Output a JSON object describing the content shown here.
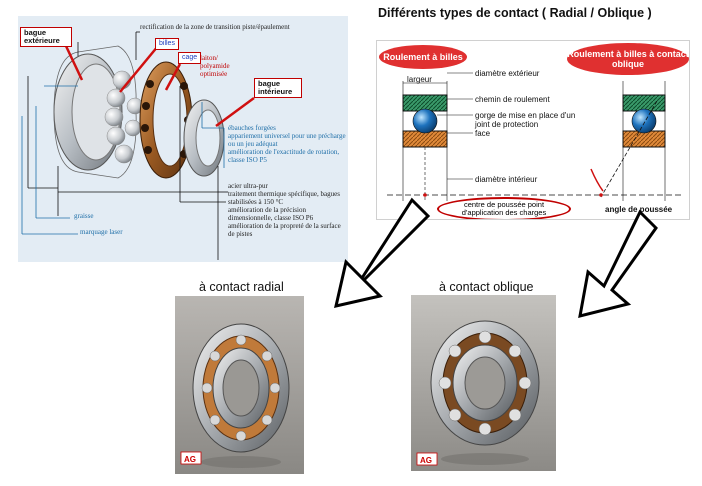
{
  "title": "Différents types de contact ( Radial / Oblique )",
  "left_figure": {
    "top_note": "rectification de la zone de transition piste/épaulement",
    "outer_ring_label": "bague extérieure",
    "balls_label": "billes",
    "cage_label": "cage",
    "cage_material": "laiton/ polyamide optimisée",
    "inner_ring_label": "bague intérieure",
    "blue_features": [
      "ébauches forgées",
      "appariement universel pour une précharge ou un jeu adéquat",
      "amélioration de l'exactitude de rotation, classe ISO P5"
    ],
    "black_features": [
      "acier ultra-pur",
      "traitement thermique spécifique, bagues stabilisées à 150 °C",
      "amélioration de la précision dimensionnelle, classe ISO P6",
      "amélioration de la propreté de la surface de pistes"
    ],
    "grease_label": "graisse",
    "laser_label": "marquage laser"
  },
  "right_figure": {
    "radial_heading": "Roulement à billes",
    "oblique_heading": "Roulement à billes à contact oblique",
    "labels": {
      "width": "largeur",
      "outer_diameter": "diamètre extérieur",
      "raceway": "chemin de roulement",
      "groove": "gorge de mise en place d'un joint de protection",
      "face": "face",
      "inner_diameter": "diamètre intérieur",
      "thrust_center": "centre de poussée point d'application des charges",
      "thrust_angle": "angle de poussée"
    }
  },
  "photos": {
    "radial_caption": "à contact radial",
    "oblique_caption": "à contact oblique",
    "logo_text": "AG"
  },
  "colors": {
    "red": "#e03030",
    "panel_bg": "#e3ecf4",
    "blue_text": "#1f6fa8",
    "outer_ring_hatch": "#2e8b57",
    "inner_ring_hatch": "#d2691e",
    "ball": "#1e73be"
  }
}
